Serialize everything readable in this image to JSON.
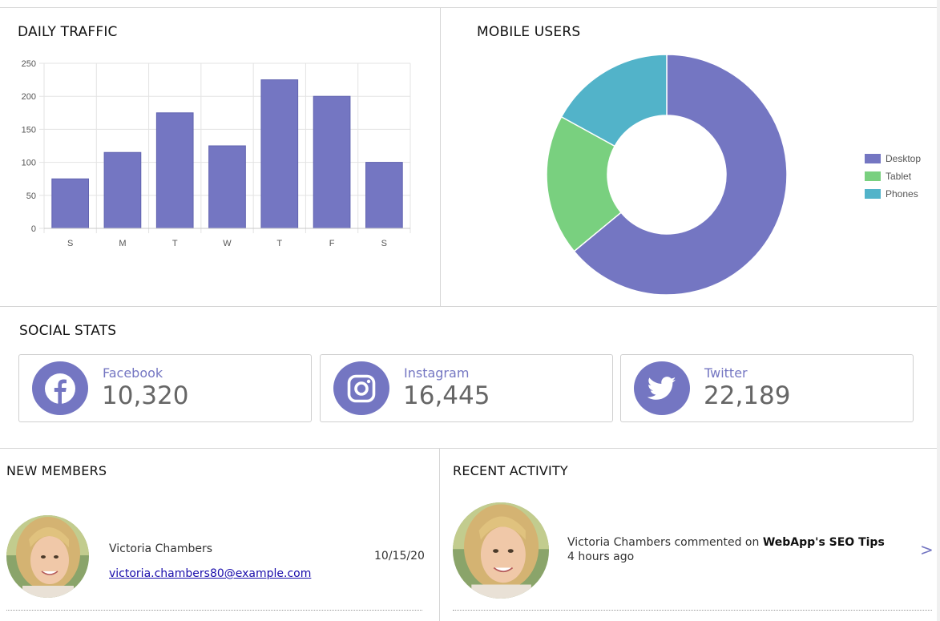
{
  "daily_traffic": {
    "title": "DAILY TRAFFIC"
  },
  "chart_data": {
    "type": "bar",
    "categories": [
      "S",
      "M",
      "T",
      "W",
      "T",
      "F",
      "S"
    ],
    "values": [
      75,
      115,
      175,
      125,
      225,
      200,
      100
    ],
    "ylim": [
      0,
      250
    ],
    "yticks": [
      0,
      50,
      100,
      150,
      200,
      250
    ],
    "grid": true,
    "color": "#7476c2"
  },
  "mobile_users": {
    "title": "MOBILE USERS",
    "chart_data": {
      "type": "pie",
      "labels": [
        "Desktop",
        "Tablet",
        "Phones"
      ],
      "values": [
        64,
        19,
        17
      ],
      "colors": [
        "#7476c2",
        "#79d07f",
        "#52b3c9"
      ],
      "legend": "right"
    }
  },
  "social_stats": {
    "title": "SOCIAL STATS",
    "items": [
      {
        "name": "Facebook",
        "count": "10,320",
        "icon": "facebook-icon"
      },
      {
        "name": "Instagram",
        "count": "16,445",
        "icon": "instagram-icon"
      },
      {
        "name": "Twitter",
        "count": "22,189",
        "icon": "twitter-icon"
      }
    ]
  },
  "new_members": {
    "title": "NEW MEMBERS",
    "members": [
      {
        "name": "Victoria Chambers",
        "email": "victoria.chambers80@example.com",
        "date": "10/15/20"
      }
    ]
  },
  "recent_activity": {
    "title": "RECENT ACTIVITY",
    "items": [
      {
        "user": "Victoria Chambers",
        "action": "commented on",
        "target": "WebApp's SEO Tips",
        "time": "4 hours ago"
      }
    ]
  },
  "colors": {
    "accent": "#7476c2",
    "tablet": "#79d07f",
    "phones": "#52b3c9",
    "border": "#d6d6d6"
  }
}
